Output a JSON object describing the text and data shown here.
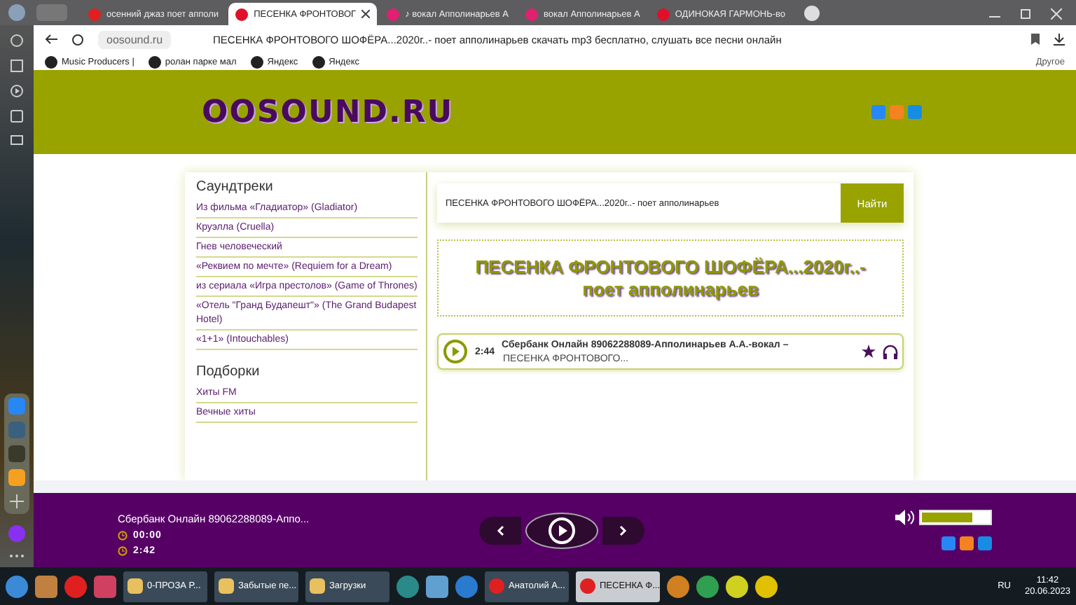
{
  "browser": {
    "tabs": [
      {
        "label": "осенний джаз поет апполи",
        "selected": false
      },
      {
        "label": "ПЕСЕНКА ФРОНТОВОГ",
        "selected": true
      },
      {
        "label": "♪ вокал Апполинарьев А",
        "selected": false
      },
      {
        "label": "вокал Апполинарьев А",
        "selected": false
      },
      {
        "label": "ОДИНОКАЯ ГАРМОНЬ-во",
        "selected": false
      }
    ],
    "url": "oosound.ru",
    "page_title": "ПЕСЕНКА ФРОНТОВОГО ШОФЁРА...2020г..- поет апполинарьев скачать mp3 бесплатно, слушать все песни онлайн",
    "bookmarks": [
      "Music Producers |",
      "ролан парке мал",
      "Яндекс",
      "Яндекс"
    ],
    "other": "Другое"
  },
  "site": {
    "logo": "OOSOUND.RU",
    "sidebar": [
      {
        "heading": "Саундтреки",
        "items": [
          "Из фильма «Гладиатор» (Gladiator)",
          "Круэлла (Cruella)",
          "Гнев человеческий",
          "«Реквием по мечте» (Requiem for a Dream)",
          "из сериала «Игра престолов» (Game of Thrones)",
          "«Отель \"Гранд Будапешт\"» (The Grand Budapest Hotel)",
          "«1+1» (Intouchables)"
        ]
      },
      {
        "heading": "Подборки",
        "items": [
          "Хиты FM",
          "Вечные хиты"
        ]
      }
    ],
    "search": {
      "value": "ПЕСЕНКА ФРОНТОВОГО ШОФЁРА...2020г..- поет апполинарьев",
      "button": "Найти"
    },
    "title": "ПЕСЕНКА ФРОНТОВОГО ШОФЁРА...2020г..- поет апполинарьев",
    "tracks": [
      {
        "duration": "2:44",
        "artist": "Сбербанк Онлайн 89062288089-Апполинарьев А.А.-вокал –",
        "song": "ПЕСЕНКА ФРОНТОВОГО..."
      }
    ]
  },
  "player": {
    "title": "Сбербанк Онлайн 89062288089-Аппо...",
    "elapsed": "00:00",
    "total": "2:42",
    "volume": {
      "level": 0.75
    }
  },
  "taskbar": {
    "buttons": [
      {
        "label": "0-ПРОЗА Р...",
        "selected": false
      },
      {
        "label": "Забытые пе...",
        "selected": false
      },
      {
        "label": "Загрузки",
        "selected": false
      },
      {
        "label": "Анатолий А...",
        "selected": false
      },
      {
        "label": "ПЕСЕНКА Ф...",
        "selected": true
      }
    ],
    "lang": "RU",
    "time": "11:42",
    "date": "20.06.2023"
  }
}
